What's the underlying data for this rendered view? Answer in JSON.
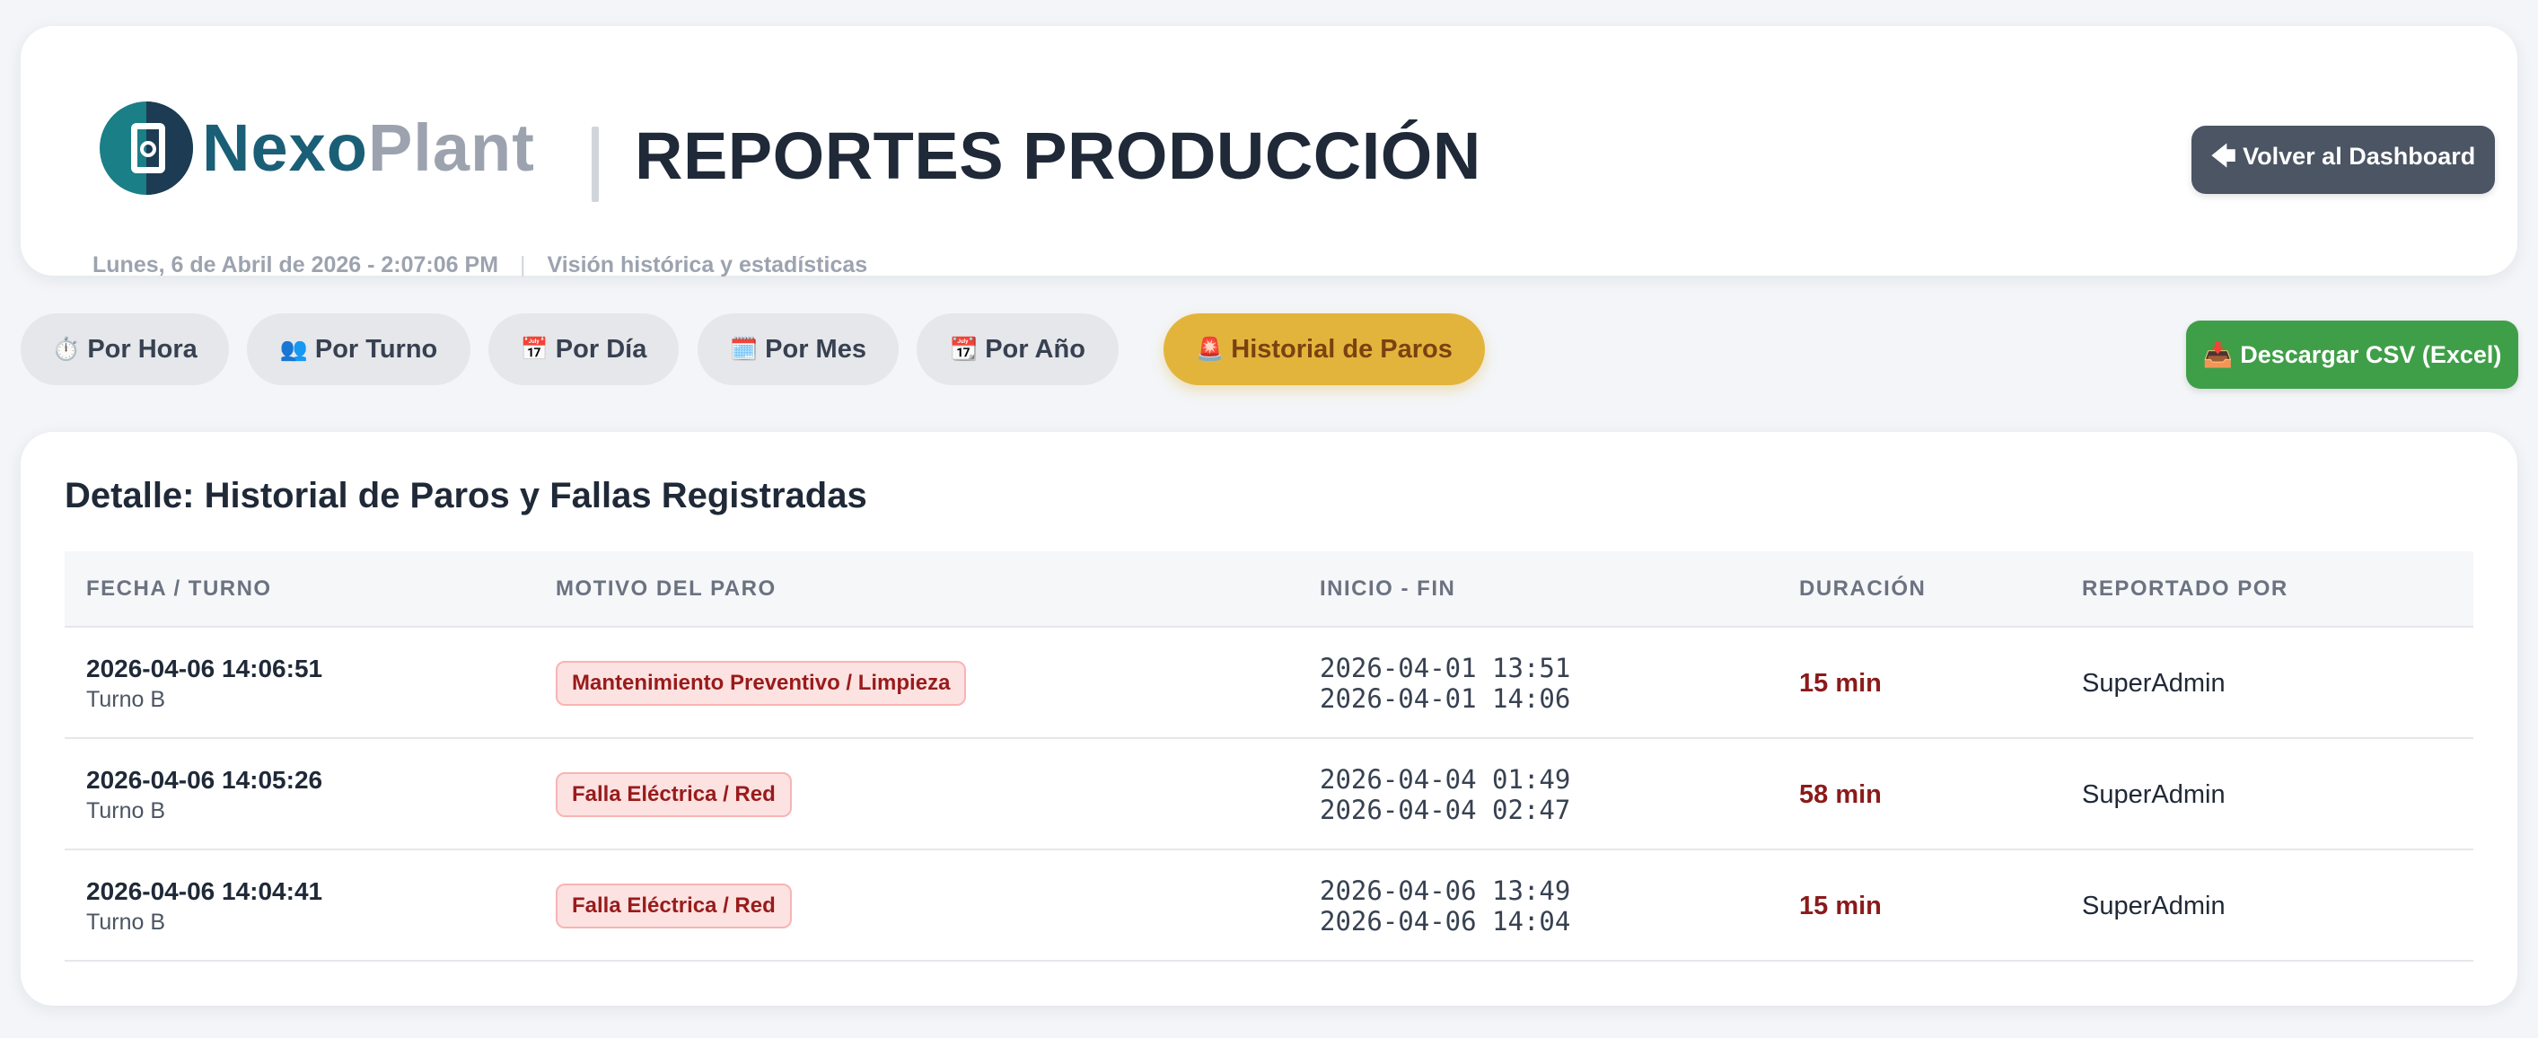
{
  "brand": {
    "name_part1": "Nexo",
    "name_part2": "Plant"
  },
  "header": {
    "title": "REPORTES PRODUCCIÓN",
    "back_button": "🡄 Volver al Dashboard",
    "datetime": "Lunes, 6 de Abril de 2026 - 2:07:06 PM",
    "separator": "|",
    "subtitle": "Visión histórica y estadísticas"
  },
  "tabs": [
    {
      "icon": "⏱️",
      "label": "Por Hora",
      "active": false
    },
    {
      "icon": "👥",
      "label": "Por Turno",
      "active": false
    },
    {
      "icon": "📅",
      "label": "Por Día",
      "active": false
    },
    {
      "icon": "🗓️",
      "label": "Por Mes",
      "active": false
    },
    {
      "icon": "📆",
      "label": "Por Año",
      "active": false
    },
    {
      "icon": "🚨",
      "label": "Historial de Paros",
      "active": true
    }
  ],
  "csv_button": {
    "icon": "📥",
    "label": "Descargar CSV (Excel)"
  },
  "detail": {
    "title": "Detalle: Historial de Paros y Fallas Registradas",
    "columns": [
      "FECHA / TURNO",
      "MOTIVO DEL PARO",
      "INICIO - FIN",
      "DURACIÓN",
      "REPORTADO POR"
    ],
    "rows": [
      {
        "fecha": "2026-04-06 14:06:51",
        "turno": "Turno B",
        "motivo": "Mantenimiento Preventivo / Limpieza",
        "inicio": "2026-04-01 13:51",
        "fin": "2026-04-01 14:06",
        "duracion": "15 min",
        "reportado": "SuperAdmin"
      },
      {
        "fecha": "2026-04-06 14:05:26",
        "turno": "Turno B",
        "motivo": "Falla Eléctrica / Red",
        "inicio": "2026-04-04 01:49",
        "fin": "2026-04-04 02:47",
        "duracion": "58 min",
        "reportado": "SuperAdmin"
      },
      {
        "fecha": "2026-04-06 14:04:41",
        "turno": "Turno B",
        "motivo": "Falla Eléctrica / Red",
        "inicio": "2026-04-06 13:49",
        "fin": "2026-04-06 14:04",
        "duracion": "15 min",
        "reportado": "SuperAdmin"
      }
    ]
  },
  "colors": {
    "accent": "#e3b43c",
    "success": "#3f9f48",
    "danger": "#991b1b",
    "brand": "#1b5f77"
  }
}
